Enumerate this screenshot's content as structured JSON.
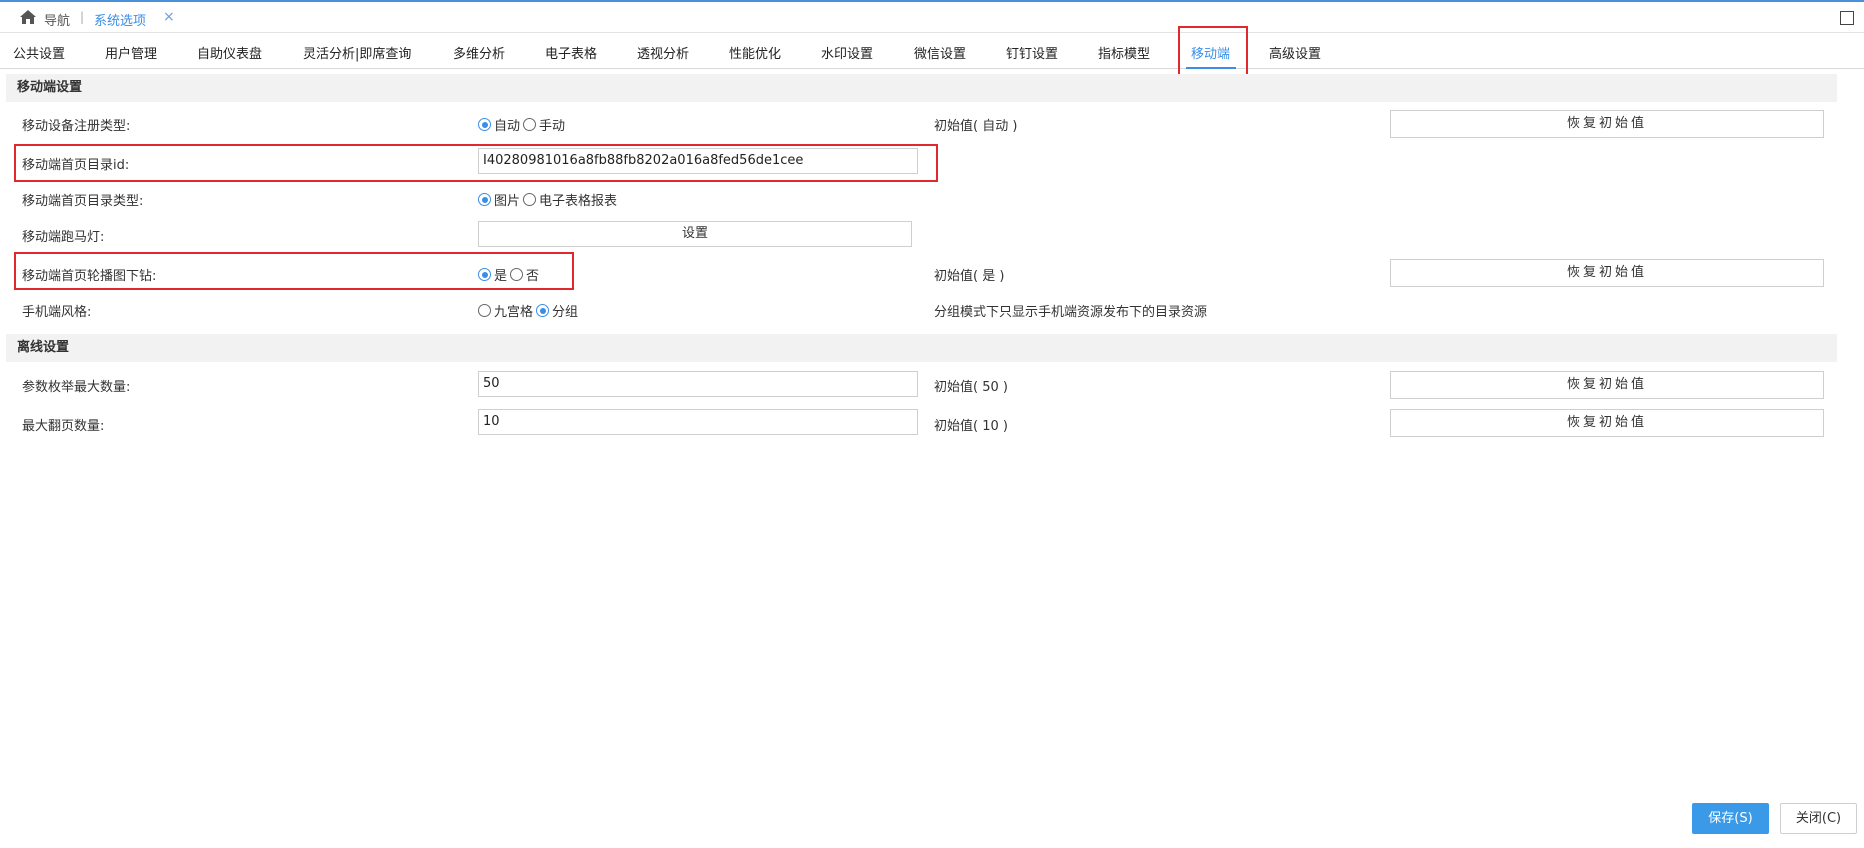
{
  "navbar": {
    "home_label": "导航",
    "separator": "|",
    "tab_label": "系统选项",
    "close_glyph": "×"
  },
  "tabs": [
    {
      "label": "公共设置"
    },
    {
      "label": "用户管理"
    },
    {
      "label": "自助仪表盘"
    },
    {
      "label": "灵活分析|即席查询"
    },
    {
      "label": "多维分析"
    },
    {
      "label": "电子表格"
    },
    {
      "label": "透视分析"
    },
    {
      "label": "性能优化"
    },
    {
      "label": "水印设置"
    },
    {
      "label": "微信设置"
    },
    {
      "label": "钉钉设置"
    },
    {
      "label": "指标模型"
    },
    {
      "label": "移动端",
      "active": true
    },
    {
      "label": "高级设置"
    }
  ],
  "mobile": {
    "section_title": "移动端设置",
    "register_type": {
      "label": "移动设备注册类型:",
      "options": [
        "自动",
        "手动"
      ],
      "selected": "自动",
      "initial": "初始值( 自动 )",
      "restore_label": "恢复初始值"
    },
    "home_dir_id": {
      "label": "移动端首页目录id:",
      "value": "I40280981016a8fb88fb8202a016a8fed56de1cee"
    },
    "home_dir_type": {
      "label": "移动端首页目录类型:",
      "options": [
        "图片",
        "电子表格报表"
      ],
      "selected": "图片"
    },
    "marquee": {
      "label": "移动端跑马灯:",
      "button_label": "设置"
    },
    "carousel_drill": {
      "label": "移动端首页轮播图下钻:",
      "options": [
        "是",
        "否"
      ],
      "selected": "是",
      "initial": "初始值( 是 )",
      "restore_label": "恢复初始值"
    },
    "phone_style": {
      "label": "手机端风格:",
      "options": [
        "九宫格",
        "分组"
      ],
      "selected": "分组",
      "note": "分组模式下只显示手机端资源发布下的目录资源"
    }
  },
  "offline": {
    "section_title": "离线设置",
    "param_enum_max": {
      "label": "参数枚举最大数量:",
      "value": "50",
      "initial": "初始值( 50 )",
      "restore_label": "恢复初始值"
    },
    "max_pages": {
      "label": "最大翻页数量:",
      "value": "10",
      "initial": "初始值( 10 )",
      "restore_label": "恢复初始值"
    }
  },
  "footer": {
    "save_label": "保存(S)",
    "close_label": "关闭(C)"
  },
  "colors": {
    "accent": "#3a8ee6",
    "highlight": "#e0282e",
    "section_bg": "#f2f2f2"
  }
}
